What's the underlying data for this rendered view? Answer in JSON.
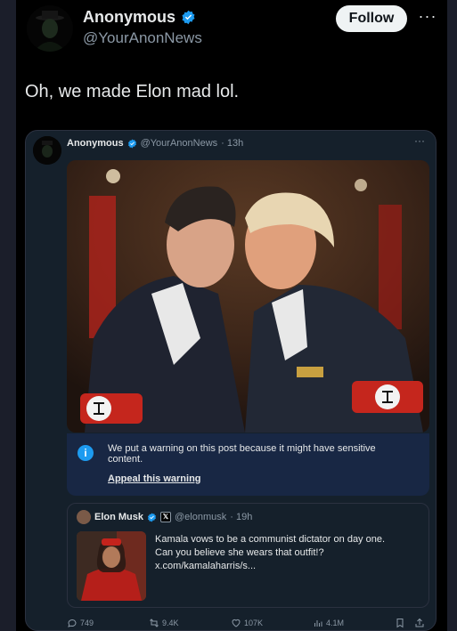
{
  "post": {
    "author_name": "Anonymous",
    "author_handle": "@YourAnonNews",
    "follow_label": "Follow",
    "more_label": "···",
    "text": "Oh, we made Elon mad lol."
  },
  "quoted_post": {
    "author_name": "Anonymous",
    "author_handle": "@YourAnonNews",
    "time": "· 13h",
    "more_label": "···",
    "warning": {
      "text": "We put a warning on this post because it might have sensitive content.",
      "appeal_label": "Appeal this warning"
    },
    "inner_quote": {
      "author_name": "Elon Musk",
      "author_handle": "@elonmusk",
      "time": "· 19h",
      "badge_label": "𝕏",
      "lines": [
        "Kamala vows to be a communist dictator on day one.",
        "Can you believe she wears that outfit!?",
        "x.com/kamalaharris/s..."
      ]
    },
    "actions": {
      "replies": "749",
      "reposts": "9.4K",
      "likes": "107K",
      "views": "4.1M"
    }
  },
  "colors": {
    "background": "#000000",
    "card": "#15202b",
    "warning_bg": "#182744",
    "accent": "#1d9bf0",
    "muted_text": "#8b98a5"
  },
  "icons": [
    "verified-icon",
    "more-icon",
    "info-icon",
    "x-logo-icon",
    "reply-icon",
    "repost-icon",
    "like-icon",
    "views-icon",
    "bookmark-icon",
    "share-icon"
  ]
}
